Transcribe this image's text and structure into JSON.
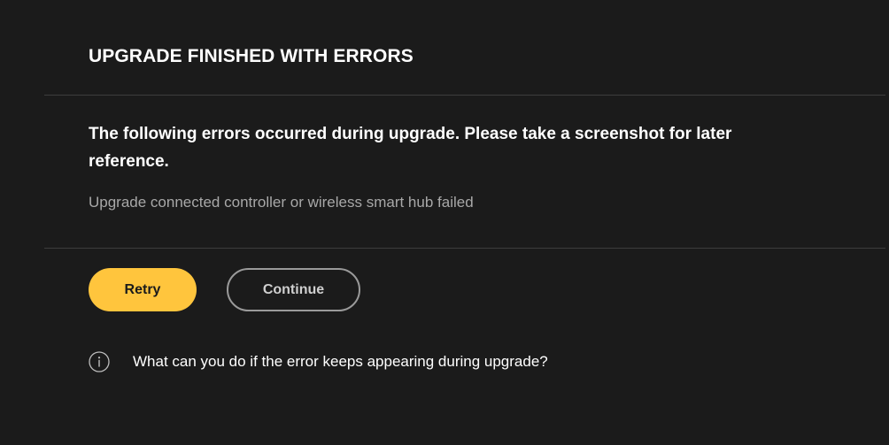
{
  "dialog": {
    "title": "UPGRADE FINISHED WITH ERRORS",
    "message": "The following errors occurred during upgrade. Please take a screenshot for later reference.",
    "errors": [
      "Upgrade connected controller or wireless smart hub failed"
    ]
  },
  "actions": {
    "retry_label": "Retry",
    "continue_label": "Continue"
  },
  "help": {
    "icon": "info-icon",
    "link_text": "What can you do if the error keeps appearing during upgrade?"
  },
  "colors": {
    "background": "#1b1b1b",
    "accent": "#ffc53d",
    "secondary_text": "#a8a8a8",
    "divider": "#3d3d3d"
  }
}
